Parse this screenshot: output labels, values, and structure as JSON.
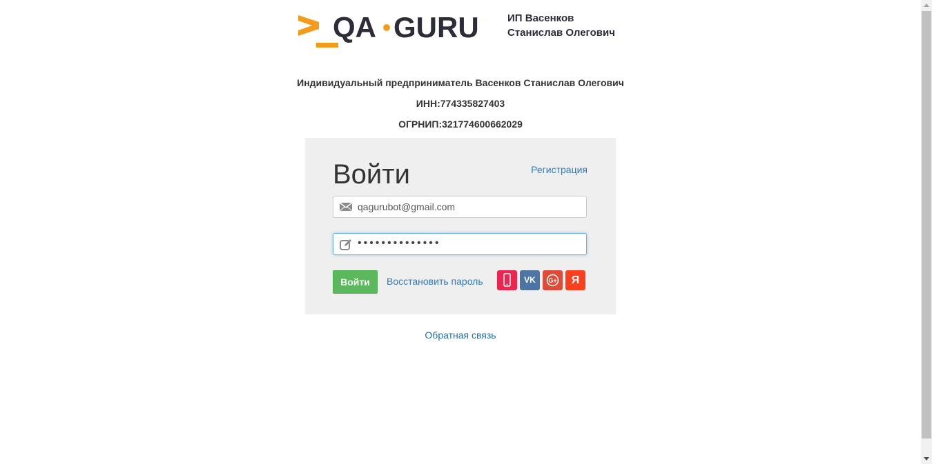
{
  "header": {
    "logo_text": "QA·GURU",
    "owner_line1": "ИП Васенков",
    "owner_line2": "Станислав Олегович"
  },
  "info": {
    "company": "Индивидуальный предприниматель Васенков Станислав Олегович",
    "inn": "ИНН:774335827403",
    "ogrnip": "ОГРНИП:321774600662029"
  },
  "login": {
    "title": "Войти",
    "register_label": "Регистрация",
    "email_value": "qagurubot@gmail.com",
    "password_value": "••••••••••••••",
    "submit_label": "Войти",
    "restore_label": "Восстановить пароль",
    "social": {
      "phone_icon": "phone-icon",
      "vk_label": "VK",
      "google_label": "G+",
      "yandex_label": "Я"
    }
  },
  "footer": {
    "feedback_label": "Обратная связь"
  },
  "colors": {
    "accent_orange": "#f39c1b",
    "logo_dark": "#2d2d3a",
    "success_green": "#5cb85c",
    "link_blue": "#337ab7"
  }
}
